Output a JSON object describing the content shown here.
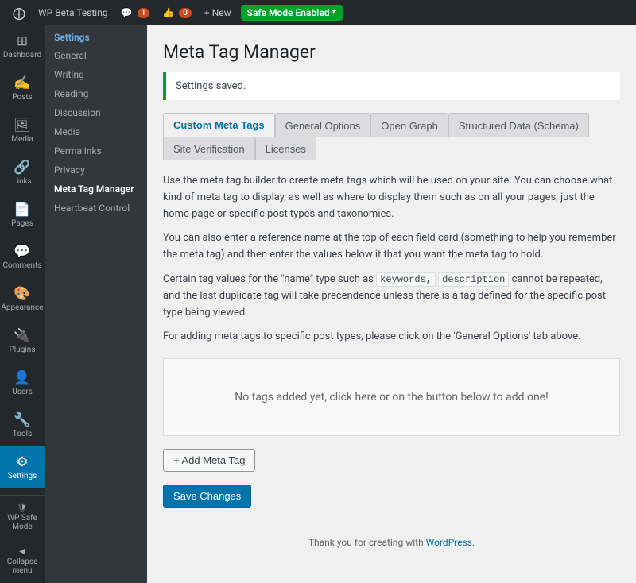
{
  "adminbar": {
    "logo_label": "WP",
    "site_name": "WP Beta Testing",
    "comments_count": "1",
    "likes_count": "0",
    "new_label": "+ New",
    "safe_mode_label": "Safe Mode Enabled *"
  },
  "sidebar": {
    "icons": [
      {
        "id": "dashboard",
        "label": "Dashboard",
        "icon": "⊞"
      },
      {
        "id": "posts",
        "label": "Posts",
        "icon": "✍"
      },
      {
        "id": "media",
        "label": "Media",
        "icon": "🖼"
      },
      {
        "id": "links",
        "label": "Links",
        "icon": "🔗"
      },
      {
        "id": "pages",
        "label": "Pages",
        "icon": "📄"
      },
      {
        "id": "comments",
        "label": "Comments",
        "icon": "💬"
      },
      {
        "id": "appearance",
        "label": "Appearance",
        "icon": "🎨"
      },
      {
        "id": "plugins",
        "label": "Plugins",
        "icon": "🔌"
      },
      {
        "id": "users",
        "label": "Users",
        "icon": "👤"
      },
      {
        "id": "tools",
        "label": "Tools",
        "icon": "🔧"
      },
      {
        "id": "settings",
        "label": "Settings",
        "icon": "⚙",
        "active": true
      }
    ],
    "sub_section_title": "Settings",
    "sub_items": [
      {
        "label": "General",
        "active": false
      },
      {
        "label": "Writing",
        "active": false
      },
      {
        "label": "Reading",
        "active": false
      },
      {
        "label": "Discussion",
        "active": false
      },
      {
        "label": "Media",
        "active": false
      },
      {
        "label": "Permalinks",
        "active": false
      },
      {
        "label": "Privacy",
        "active": false
      },
      {
        "label": "Meta Tag Manager",
        "active": true
      },
      {
        "label": "Heartbeat Control",
        "active": false
      }
    ],
    "wp_safe_mode_label": "WP Safe Mode",
    "collapse_label": "Collapse menu"
  },
  "page": {
    "title": "Meta Tag Manager",
    "notice": "Settings saved.",
    "tabs": [
      {
        "label": "Custom Meta Tags",
        "active": true
      },
      {
        "label": "General Options",
        "active": false
      },
      {
        "label": "Open Graph",
        "active": false
      },
      {
        "label": "Structured Data (Schema)",
        "active": false
      },
      {
        "label": "Site Verification",
        "active": false
      },
      {
        "label": "Licenses",
        "active": false
      }
    ],
    "description1": "Use the meta tag builder to create meta tags which will be used on your site. You can choose what kind of meta tag to display, as well as where to display them such as on all your pages, just the home page or specific post types and taxonomies.",
    "description2": "You can also enter a reference name at the top of each field card (something to help you remember the meta tag) and then enter the values below it that you want the meta tag to hold.",
    "description3_prefix": "Certain tag values for the \"name\" type such as ",
    "description3_code1": "keywords,",
    "description3_code2": "description",
    "description3_suffix": " cannot be repeated, and the last duplicate tag will take precendence unless there is a tag defined for the specific post type being viewed.",
    "description4": "For adding meta tags to specific post types, please click on the 'General Options' tab above.",
    "empty_area_text": "No tags added yet, click here or on the button below to add one!",
    "add_meta_tag_label": "+ Add Meta Tag",
    "save_changes_label": "Save Changes",
    "footer_text": "Thank you for creating with ",
    "footer_link": "WordPress",
    "footer_period": "."
  }
}
